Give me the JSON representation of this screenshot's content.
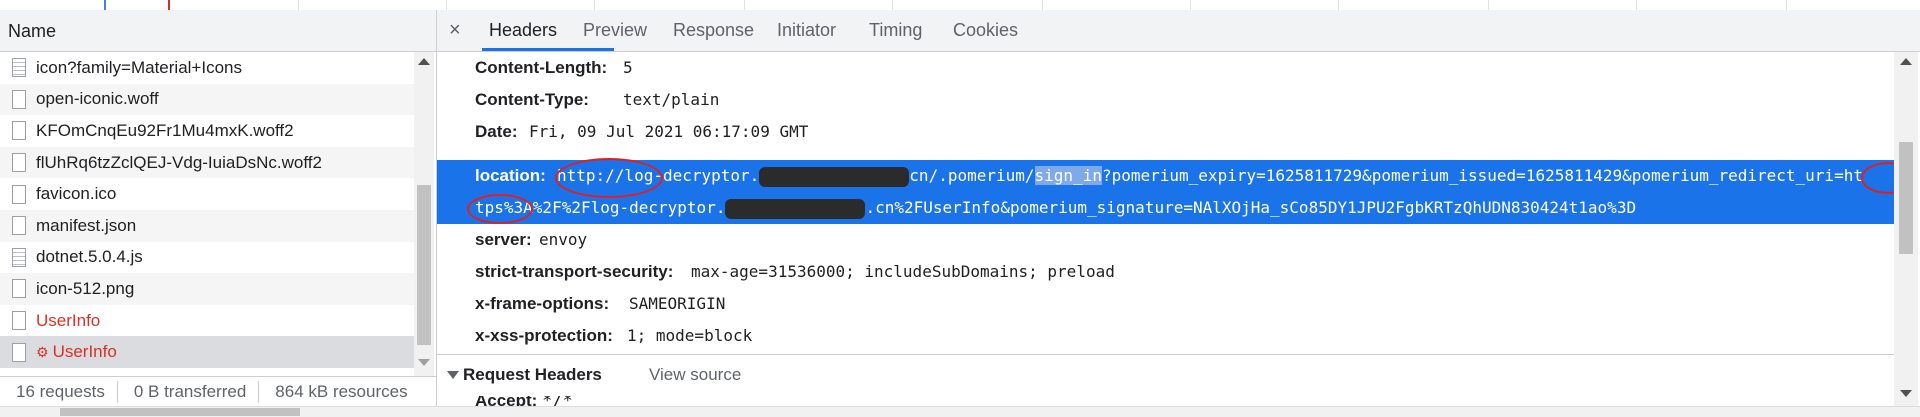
{
  "network_list": {
    "column_header": "Name",
    "items": [
      {
        "name": "icon?family=Material+Icons",
        "icon": "stylesheet-file-icon",
        "status": "normal"
      },
      {
        "name": "open-iconic.woff",
        "icon": "file-icon",
        "status": "normal"
      },
      {
        "name": "KFOmCnqEu92Fr1Mu4mxK.woff2",
        "icon": "file-icon",
        "status": "normal"
      },
      {
        "name": "flUhRq6tzZclQEJ-Vdg-IuiaDsNc.woff2",
        "icon": "file-icon",
        "status": "normal"
      },
      {
        "name": "favicon.ico",
        "icon": "file-icon",
        "status": "normal"
      },
      {
        "name": "manifest.json",
        "icon": "file-icon",
        "status": "normal"
      },
      {
        "name": "dotnet.5.0.4.js",
        "icon": "script-file-icon",
        "status": "normal"
      },
      {
        "name": "icon-512.png",
        "icon": "file-icon",
        "status": "normal"
      },
      {
        "name": "UserInfo",
        "icon": "file-icon",
        "status": "error"
      },
      {
        "name": "UserInfo",
        "icon": "file-icon",
        "status": "error-preflight"
      }
    ]
  },
  "status_bar": {
    "requests": "16 requests",
    "transferred": "0 B transferred",
    "resources": "864 kB resources"
  },
  "details": {
    "close_label": "×",
    "tabs": [
      "Headers",
      "Preview",
      "Response",
      "Initiator",
      "Timing",
      "Cookies"
    ],
    "active_tab": "Headers",
    "response_headers": [
      {
        "key": "Content-Length:",
        "value": "5"
      },
      {
        "key": "Content-Type:",
        "value": "text/plain"
      },
      {
        "key": "Date:",
        "value": "Fri, 09 Jul 2021 06:17:09 GMT"
      }
    ],
    "location": {
      "key": "location:",
      "line1_a": "http://log-decryptor.",
      "line1_b": "cn/.pomerium/",
      "line1_hl": "sign_in",
      "line1_c": "?pomerium_expiry=1625811729&pomerium_issued=1625811429&pomerium_redirect_uri=ht",
      "line2_a": "tps%3A%2F%2Flog-decryptor.",
      "line2_b": ".cn%2FUserInfo&pomerium_signature=NAlXOjHa_sCo85DY1JPU2FgbKRTzQhUDN830424t1ao%3D"
    },
    "response_headers_after": [
      {
        "key": "server:",
        "value": "envoy"
      },
      {
        "key": "strict-transport-security:",
        "value": "max-age=31536000; includeSubDomains; preload"
      },
      {
        "key": "x-frame-options:",
        "value": "SAMEORIGIN"
      },
      {
        "key": "x-xss-protection:",
        "value": "1; mode=block"
      }
    ],
    "request_headers": {
      "title": "Request Headers",
      "view_source": "View source",
      "first_key": "Accept:",
      "first_value": "*/*"
    }
  },
  "colors": {
    "selection": "#1a73e8",
    "error_text": "#d93025",
    "annotation": "#e02020"
  }
}
